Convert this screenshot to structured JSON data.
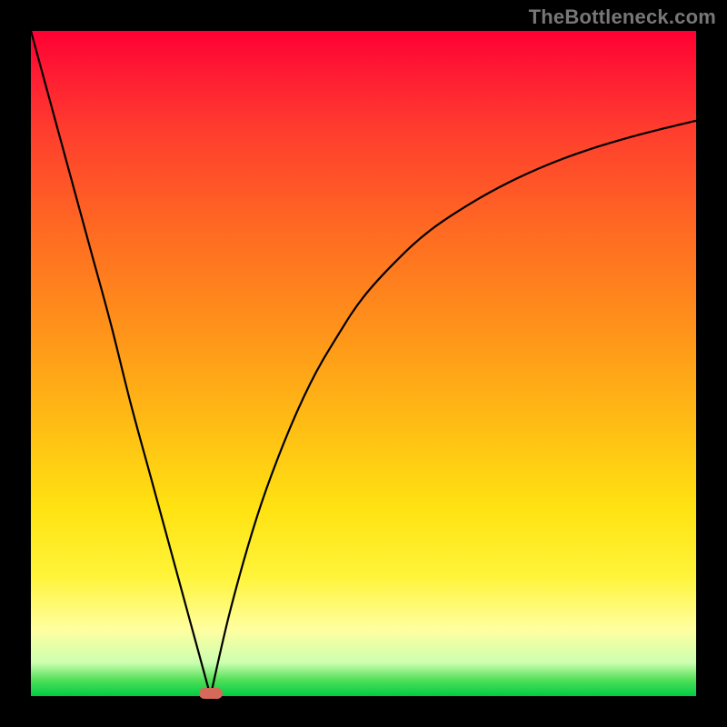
{
  "watermark": "TheBottleneck.com",
  "colors": {
    "frame": "#000000",
    "curve": "#000000",
    "marker": "#d66a5a",
    "gradient_stops": [
      "#ff0033",
      "#ff6a22",
      "#ffbf14",
      "#ffffa0",
      "#00cc44"
    ]
  },
  "chart_data": {
    "type": "line",
    "title": "",
    "xlabel": "",
    "ylabel": "",
    "xlim": [
      0,
      100
    ],
    "ylim": [
      0,
      100
    ],
    "grid": false,
    "legend": false,
    "annotations": [
      {
        "name": "minimum-marker",
        "x": 27,
        "y": 0
      }
    ],
    "series": [
      {
        "name": "left-branch",
        "x": [
          0,
          3,
          6,
          9,
          12,
          15,
          18,
          21,
          24,
          27
        ],
        "values": [
          100,
          89,
          78,
          67,
          56,
          44,
          33,
          22,
          11,
          0
        ]
      },
      {
        "name": "right-branch",
        "x": [
          27,
          30,
          34,
          38,
          42,
          46,
          50,
          55,
          60,
          66,
          72,
          78,
          84,
          90,
          95,
          100
        ],
        "values": [
          0,
          13,
          27,
          38,
          47,
          54,
          60,
          65.5,
          70,
          74,
          77.3,
          80,
          82.2,
          84,
          85.3,
          86.5
        ]
      }
    ]
  }
}
